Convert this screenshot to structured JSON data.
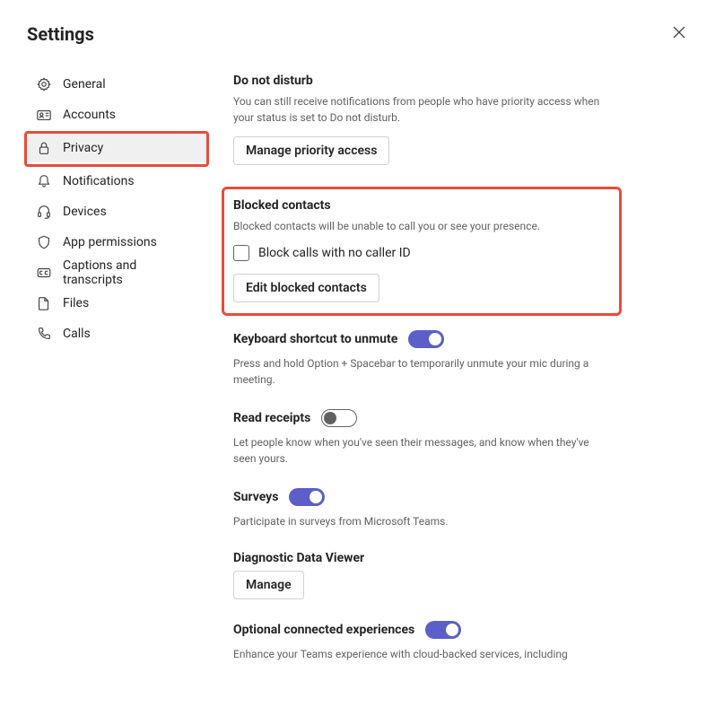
{
  "title": "Settings",
  "sidebar": {
    "items": [
      {
        "label": "General"
      },
      {
        "label": "Accounts"
      },
      {
        "label": "Privacy"
      },
      {
        "label": "Notifications"
      },
      {
        "label": "Devices"
      },
      {
        "label": "App permissions"
      },
      {
        "label": "Captions and transcripts"
      },
      {
        "label": "Files"
      },
      {
        "label": "Calls"
      }
    ]
  },
  "sections": {
    "dnd": {
      "title": "Do not disturb",
      "desc": "You can still receive notifications from people who have priority access when your status is set to Do not disturb.",
      "button": "Manage priority access"
    },
    "blocked": {
      "title": "Blocked contacts",
      "desc": "Blocked contacts will be unable to call you or see your presence.",
      "checkbox_label": "Block calls with no caller ID",
      "button": "Edit blocked contacts"
    },
    "keyboard": {
      "title": "Keyboard shortcut to unmute",
      "desc": "Press and hold Option + Spacebar to temporarily unmute your mic during a meeting."
    },
    "read": {
      "title": "Read receipts",
      "desc": "Let people know when you've seen their messages, and know when they've seen yours."
    },
    "surveys": {
      "title": "Surveys",
      "desc": "Participate in surveys from Microsoft Teams."
    },
    "diag": {
      "title": "Diagnostic Data Viewer",
      "button": "Manage"
    },
    "optional": {
      "title": "Optional connected experiences",
      "desc": "Enhance your Teams experience with cloud-backed services, including"
    }
  }
}
